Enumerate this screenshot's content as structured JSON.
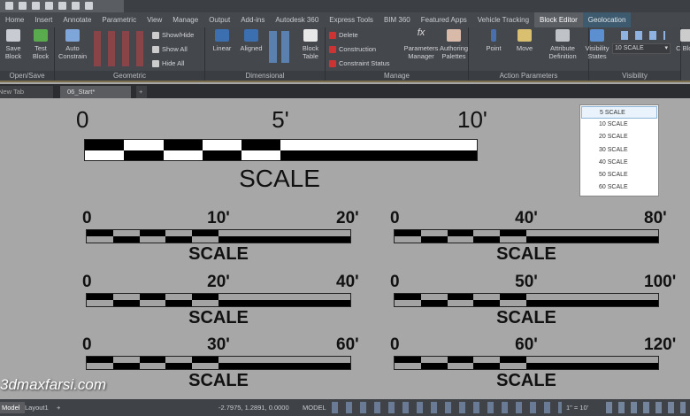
{
  "tabs": [
    "Home",
    "Insert",
    "Annotate",
    "Parametric",
    "View",
    "Manage",
    "Output",
    "Add-ins",
    "Autodesk 360",
    "Express Tools",
    "BIM 360",
    "Featured Apps",
    "Vehicle Tracking",
    "Block Editor",
    "Geolocation"
  ],
  "active_tab": "Block Editor",
  "ribbon": {
    "save_block": "Save Block",
    "test_block": "Test Block",
    "auto_constrain": "Auto Constrain",
    "show_hide": "Show/Hide",
    "show_all": "Show All",
    "hide_all": "Hide All",
    "linear": "Linear",
    "aligned": "Aligned",
    "block_table": "Block Table",
    "delete": "Delete",
    "construction": "Construction",
    "constraint_status": "Constraint Status",
    "parameters_manager": "Parameters Manager",
    "authoring_palettes": "Authoring Palettes",
    "point": "Point",
    "move": "Move",
    "attribute_definition": "Attribute Definition",
    "visibility_states": "Visibility States",
    "visibility_select": "10 SCALE",
    "close_block": "C Block",
    "panels": [
      "Open/Save",
      "Geometric",
      "Dimensional",
      "Manage",
      "Action Parameters",
      "Visibility"
    ]
  },
  "file_tabs": [
    "New Tab",
    "06_Start*"
  ],
  "big_scale": {
    "labels": [
      "0",
      "5'",
      "10'"
    ],
    "caption": "SCALE"
  },
  "scales": [
    {
      "labels": [
        "0",
        "10'",
        "20'"
      ],
      "caption": "SCALE"
    },
    {
      "labels": [
        "0",
        "40'",
        "80'"
      ],
      "caption": "SCALE"
    },
    {
      "labels": [
        "0",
        "20'",
        "40'"
      ],
      "caption": "SCALE"
    },
    {
      "labels": [
        "0",
        "50'",
        "100'"
      ],
      "caption": "SCALE"
    },
    {
      "labels": [
        "0",
        "30'",
        "60'"
      ],
      "caption": "SCALE"
    },
    {
      "labels": [
        "0",
        "60'",
        "120'"
      ],
      "caption": "SCALE"
    }
  ],
  "visibility_list": [
    "5 SCALE",
    "10 SCALE",
    "20 SCALE",
    "30 SCALE",
    "40 SCALE",
    "50 SCALE",
    "60 SCALE"
  ],
  "watermark": "3dmaxfarsi.com",
  "status": {
    "model_tab": "Model",
    "layout_tab": "Layout1",
    "coords": "-2.7975, 1.2891, 0.0000",
    "space": "MODEL",
    "annoscale": "1\" = 10'"
  }
}
